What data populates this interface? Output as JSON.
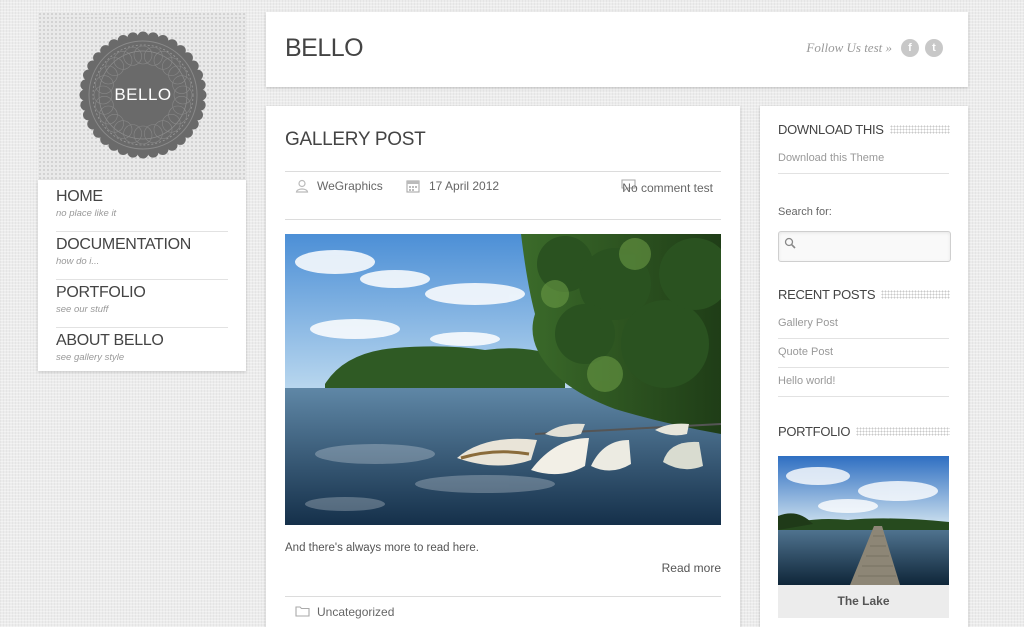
{
  "logo": {
    "text": "BELLO"
  },
  "nav": [
    {
      "label": "HOME",
      "sub": "no place like it"
    },
    {
      "label": "DOCUMENTATION",
      "sub": "how do i..."
    },
    {
      "label": "PORTFOLIO",
      "sub": "see our stuff"
    },
    {
      "label": "ABOUT BELLO",
      "sub": "see gallery style"
    }
  ],
  "header": {
    "title": "BELLO",
    "follow_text": "Follow Us test »",
    "facebook_glyph": "f",
    "twitter_glyph": "t"
  },
  "post": {
    "title": "GALLERY POST",
    "author": "WeGraphics",
    "date": "17 April 2012",
    "comments": "No comment test",
    "excerpt": "And there's always more to read here.",
    "read_more": "Read more",
    "category": "Uncategorized",
    "next_glyph": "›"
  },
  "sidebar": {
    "download": {
      "title": "DOWNLOAD THIS",
      "link": "Download this Theme"
    },
    "search": {
      "label": "Search for:",
      "placeholder": ""
    },
    "recent": {
      "title": "RECENT POSTS",
      "items": [
        "Gallery Post",
        "Quote Post",
        "Hello world!"
      ]
    },
    "portfolio": {
      "title": "PORTFOLIO",
      "caption": "The Lake"
    }
  },
  "colors": {
    "background": "#ececec",
    "card": "#ffffff",
    "logo_badge": "#6e6e6e",
    "text_dark": "#444444",
    "text_muted": "#999999"
  },
  "icons": {
    "author": "user-icon",
    "date": "calendar-icon",
    "comments": "comment-bubble-icon",
    "category": "folder-icon",
    "search": "search-icon",
    "facebook": "facebook-icon",
    "twitter": "twitter-icon",
    "next": "chevron-right-icon"
  }
}
